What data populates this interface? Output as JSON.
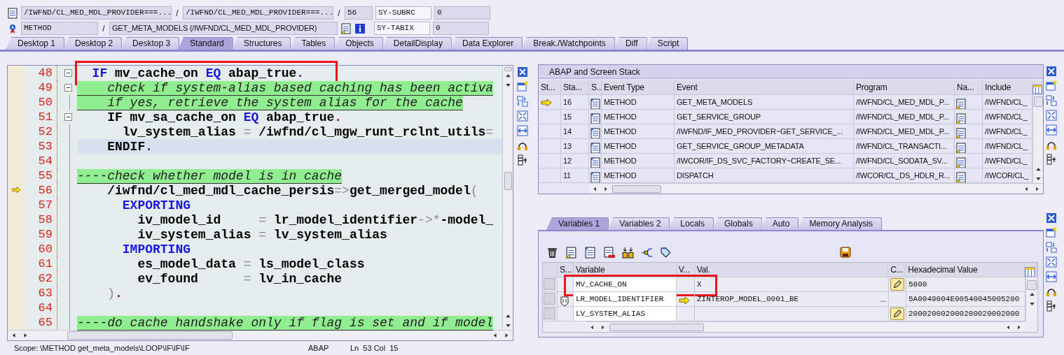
{
  "header": {
    "rows": [
      {
        "items": [
          {
            "kind": "field",
            "text": "/IWFND/CL_MED_MDL_PROVIDER===..."
          },
          {
            "kind": "sep",
            "text": "/"
          },
          {
            "kind": "field",
            "text": "/IWFND/CL_MED_MDL_PROVIDER===..."
          },
          {
            "kind": "sep",
            "text": "/"
          },
          {
            "kind": "field",
            "text": "56"
          },
          {
            "kind": "sysname",
            "text": "SY-SUBRC"
          },
          {
            "kind": "sysvalue",
            "text": "0"
          }
        ]
      },
      {
        "items": [
          {
            "kind": "field",
            "text": "METHOD"
          },
          {
            "kind": "sep",
            "text": "/"
          },
          {
            "kind": "field",
            "text": "GET_META_MODELS (/IWFND/CL_MED_MDL_PROVIDER)"
          },
          {
            "kind": "sysname",
            "text": "SY-TABIX"
          },
          {
            "kind": "sysvalue",
            "text": "0"
          }
        ]
      }
    ]
  },
  "tabs": [
    {
      "label": "Desktop 1",
      "selected": false
    },
    {
      "label": "Desktop 2",
      "selected": false
    },
    {
      "label": "Desktop 3",
      "selected": false
    },
    {
      "label": "Standard",
      "selected": true
    },
    {
      "label": "Structures",
      "selected": false
    },
    {
      "label": "Tables",
      "selected": false
    },
    {
      "label": "Objects",
      "selected": false
    },
    {
      "label": "DetailDisplay",
      "selected": false
    },
    {
      "label": "Data Explorer",
      "selected": false
    },
    {
      "label": "Break./Watchpoints",
      "selected": false
    },
    {
      "label": "Diff",
      "selected": false
    },
    {
      "label": "Script",
      "selected": false
    }
  ],
  "editor": {
    "lines": [
      {
        "number": "48",
        "fold": true,
        "current": false,
        "cursor": false,
        "annotated": true,
        "tokens": [
          {
            "kind": "kw",
            "text": "  IF"
          },
          {
            "kind": "id",
            "text": " mv_cache_on "
          },
          {
            "kind": "kw",
            "text": "EQ"
          },
          {
            "kind": "id",
            "text": " abap_true"
          },
          {
            "kind": "dot",
            "text": "."
          }
        ]
      },
      {
        "number": "49",
        "fold": true,
        "current": false,
        "cursor": false,
        "annotated": false,
        "tokens": [
          {
            "kind": "comment",
            "text": "    check if system-alias based caching has been activa"
          }
        ]
      },
      {
        "number": "50",
        "fold": false,
        "current": false,
        "cursor": false,
        "annotated": false,
        "tokens": [
          {
            "kind": "comment",
            "text": "    if yes, retrieve the system alias for the cache"
          }
        ]
      },
      {
        "number": "51",
        "fold": true,
        "current": false,
        "cursor": false,
        "annotated": false,
        "tokens": [
          {
            "kind": "id",
            "text": "    IF mv_sa_cache_on "
          },
          {
            "kind": "kw",
            "text": "EQ"
          },
          {
            "kind": "id",
            "text": " abap_true"
          },
          {
            "kind": "dot",
            "text": "."
          }
        ]
      },
      {
        "number": "52",
        "fold": false,
        "current": false,
        "cursor": false,
        "annotated": false,
        "tokens": [
          {
            "kind": "id",
            "text": "      lv_system_alias "
          },
          {
            "kind": "op",
            "text": "="
          },
          {
            "kind": "id",
            "text": " /iwfnd/cl_mgw_runt_rclnt_utils"
          },
          {
            "kind": "op",
            "text": "="
          }
        ]
      },
      {
        "number": "53",
        "fold": false,
        "current": false,
        "cursor": true,
        "annotated": false,
        "tokens": [
          {
            "kind": "id",
            "text": "    ENDIF"
          },
          {
            "kind": "dot",
            "text": "."
          }
        ]
      },
      {
        "number": "54",
        "fold": false,
        "current": false,
        "cursor": false,
        "annotated": false
      },
      {
        "number": "55",
        "fold": false,
        "current": false,
        "cursor": false,
        "annotated": false,
        "tokens": [
          {
            "kind": "comment",
            "text": "----check whether model is in cache"
          }
        ]
      },
      {
        "number": "56",
        "fold": false,
        "current": true,
        "cursor": false,
        "annotated": false,
        "tokens": [
          {
            "kind": "id",
            "text": "    /iwfnd/cl_med_mdl_cache_persis"
          },
          {
            "kind": "op",
            "text": "=>"
          },
          {
            "kind": "id",
            "text": "get_merged_model"
          },
          {
            "kind": "op",
            "text": "("
          }
        ]
      },
      {
        "number": "57",
        "fold": false,
        "current": false,
        "cursor": false,
        "annotated": false,
        "tokens": [
          {
            "kind": "kw",
            "text": "      EXPORTING"
          }
        ]
      },
      {
        "number": "58",
        "fold": false,
        "current": false,
        "cursor": false,
        "annotated": false,
        "tokens": [
          {
            "kind": "id",
            "text": "        iv_model_id     "
          },
          {
            "kind": "op",
            "text": "="
          },
          {
            "kind": "id",
            "text": " lr_model_identifier"
          },
          {
            "kind": "op",
            "text": "->*"
          },
          {
            "kind": "id",
            "text": "-model_"
          }
        ]
      },
      {
        "number": "59",
        "fold": false,
        "current": false,
        "cursor": false,
        "annotated": false,
        "tokens": [
          {
            "kind": "id",
            "text": "        iv_system_alias "
          },
          {
            "kind": "op",
            "text": "="
          },
          {
            "kind": "id",
            "text": " lv_system_alias"
          }
        ]
      },
      {
        "number": "60",
        "fold": false,
        "current": false,
        "cursor": false,
        "annotated": false,
        "tokens": [
          {
            "kind": "kw",
            "text": "      IMPORTING"
          }
        ]
      },
      {
        "number": "61",
        "fold": false,
        "current": false,
        "cursor": false,
        "annotated": false,
        "tokens": [
          {
            "kind": "id",
            "text": "        es_model_data "
          },
          {
            "kind": "op",
            "text": "="
          },
          {
            "kind": "id",
            "text": " ls_model_class"
          }
        ]
      },
      {
        "number": "62",
        "fold": false,
        "current": false,
        "cursor": false,
        "annotated": false,
        "tokens": [
          {
            "kind": "id",
            "text": "        ev_found      "
          },
          {
            "kind": "op",
            "text": "="
          },
          {
            "kind": "id",
            "text": " lv_in_cache"
          }
        ]
      },
      {
        "number": "63",
        "fold": false,
        "current": false,
        "cursor": false,
        "annotated": false,
        "tokens": [
          {
            "kind": "op",
            "text": "    )"
          },
          {
            "kind": "dot",
            "text": "."
          }
        ]
      },
      {
        "number": "64",
        "fold": false,
        "current": false,
        "cursor": false,
        "annotated": false
      },
      {
        "number": "65",
        "fold": false,
        "current": false,
        "cursor": false,
        "annotated": false,
        "tokens": [
          {
            "kind": "comment",
            "text": "----do cache handshake only if flag is set and if model"
          }
        ]
      }
    ],
    "status": {
      "scope": "Scope: \\METHOD get_meta_models\\LOOP\\IF\\IF\\IF",
      "language": "ABAP",
      "position": "Ln  53 Col  15"
    }
  },
  "stack": {
    "title": "ABAP and Screen Stack",
    "columns": [
      "St...",
      "Sta...",
      "S..",
      "Event Type",
      "Event",
      "Program",
      "Na...",
      "Include"
    ],
    "rows": [
      {
        "current": true,
        "level": "16",
        "event_type": "METHOD",
        "event": "GET_META_MODELS",
        "program": "/IWFND/CL_MED_MDL_P...",
        "include": "/IWFND/CL_"
      },
      {
        "current": false,
        "level": "15",
        "event_type": "METHOD",
        "event": "GET_SERVICE_GROUP",
        "program": "/IWFND/CL_MED_MDL_P...",
        "include": "/IWFND/CL_"
      },
      {
        "current": false,
        "level": "14",
        "event_type": "METHOD",
        "event": "/IWFND/IF_MED_PROVIDER~GET_SERVICE_...",
        "program": "/IWFND/CL_MED_MDL_P...",
        "include": "/IWFND/CL_"
      },
      {
        "current": false,
        "level": "13",
        "event_type": "METHOD",
        "event": "GET_SERVICE_GROUP_METADATA",
        "program": "/IWFND/CL_TRANSACTI...",
        "include": "/IWFND/CL_"
      },
      {
        "current": false,
        "level": "12",
        "event_type": "METHOD",
        "event": "/IWCOR/IF_DS_SVC_FACTORY~CREATE_SE...",
        "program": "/IWFND/CL_SODATA_SV...",
        "include": "/IWFND/CL_"
      },
      {
        "current": false,
        "level": "11",
        "event_type": "METHOD",
        "event": "DISPATCH",
        "program": "/IWCOR/CL_DS_HDLR_R...",
        "include": "/IWCOR/CL_"
      }
    ]
  },
  "variables": {
    "tabs": [
      {
        "label": "Variables 1",
        "selected": true
      },
      {
        "label": "Variables 2",
        "selected": false
      },
      {
        "label": "Locals",
        "selected": false
      },
      {
        "label": "Globals",
        "selected": false
      },
      {
        "label": "Auto",
        "selected": false
      },
      {
        "label": "Memory Analysis",
        "selected": false
      }
    ],
    "columns": [
      "S...",
      "Variable",
      "V...",
      "Val.",
      "C...",
      "Hexadecimal Value"
    ],
    "rows": [
      {
        "name": "MV_CACHE_ON",
        "value": "X",
        "hex": "5800",
        "reference": false,
        "editable": true,
        "annotated": true
      },
      {
        "name": "LR_MODEL_IDENTIFIER",
        "value": "ZINTEROP_MODEL_0001_BE",
        "more": "...",
        "hex": "5A0049004E00540045005200",
        "reference": true,
        "editable": false,
        "annotated": false
      },
      {
        "name": "LV_SYSTEM_ALIAS",
        "hex": "200020002000200020002000",
        "reference": false,
        "editable": true,
        "annotated": false
      }
    ]
  }
}
